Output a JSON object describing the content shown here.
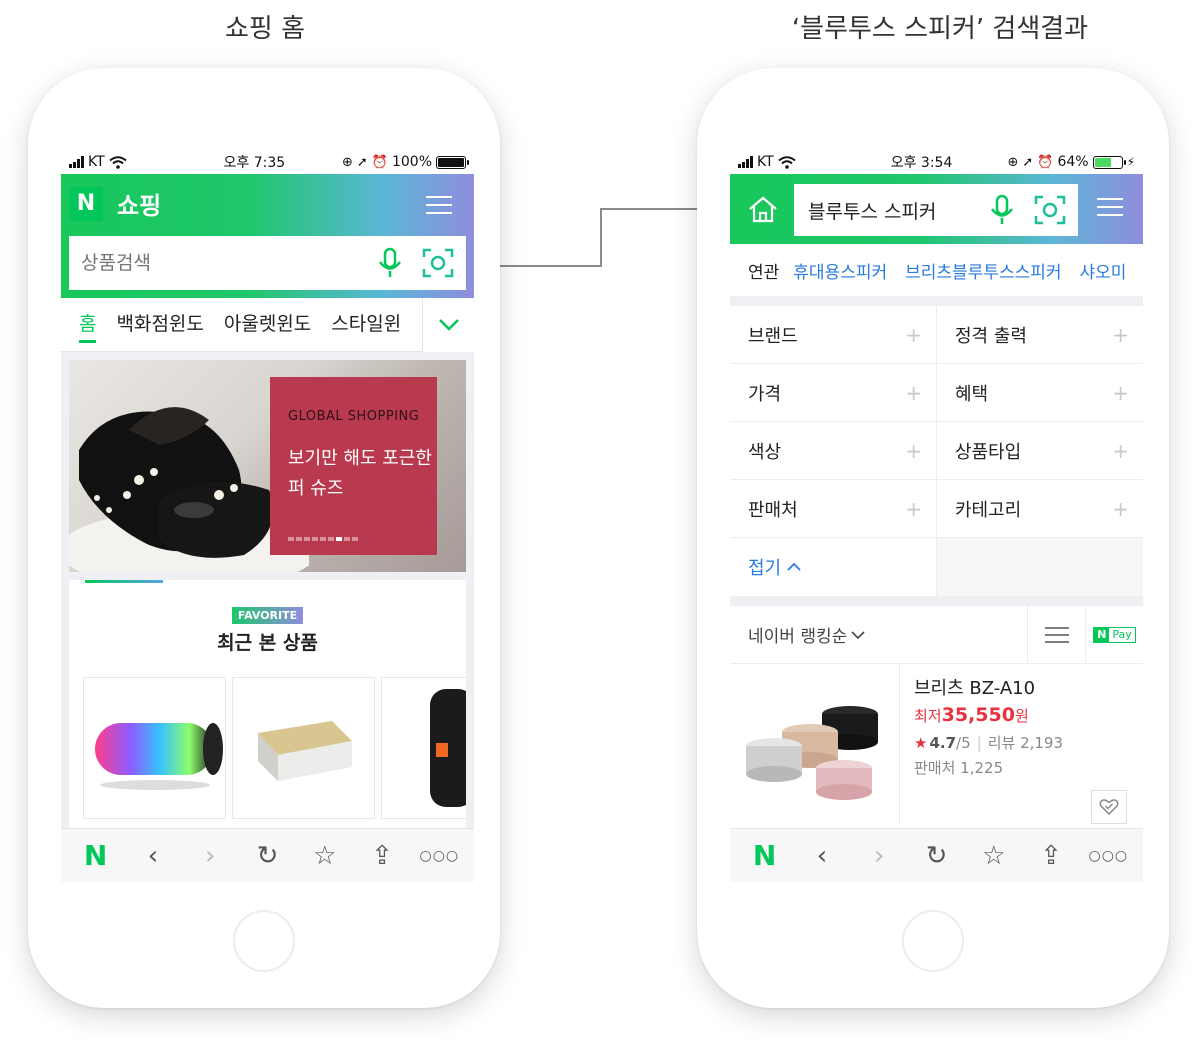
{
  "captions": {
    "left": "쇼핑 홈",
    "right": "‘블루투스 스피커’ 검색결과"
  },
  "left_phone": {
    "status": {
      "carrier": "KT",
      "time": "오후 7:35",
      "battery": "100%",
      "battery_level": 1.0
    },
    "header": {
      "logo": "N",
      "title": "쇼핑"
    },
    "search": {
      "placeholder": "상품검색"
    },
    "tabs": [
      "홈",
      "백화점윈도",
      "아울렛윈도",
      "스타일윈"
    ],
    "banner": {
      "kicker": "GLOBAL SHOPPING",
      "headline_1": "보기만 해도 포근한",
      "headline_2": "퍼 슈즈",
      "pager_count": 9,
      "pager_active": 7
    },
    "favorite": {
      "badge": "FAVORITE",
      "title": "최근 본 상품"
    }
  },
  "right_phone": {
    "status": {
      "carrier": "KT",
      "time": "오후 3:54",
      "battery": "64%",
      "battery_level": 0.64
    },
    "search": {
      "query": "블루투스 스피커"
    },
    "related": {
      "label": "연관",
      "items": [
        "휴대용스피커",
        "브리츠블루투스스피커",
        "샤오미"
      ]
    },
    "filters": [
      [
        "브랜드",
        "정격 출력"
      ],
      [
        "가격",
        "혜택"
      ],
      [
        "색상",
        "상품타입"
      ],
      [
        "판매처",
        "카테고리"
      ]
    ],
    "collapse_label": "접기",
    "sort": {
      "label": "네이버 랭킹순",
      "npay": "Pay",
      "npay_logo": "N"
    },
    "product": {
      "name": "브리츠 BZ-A10",
      "price_prefix": "최저",
      "price": "35,550",
      "price_suffix": "원",
      "rating": "4.7",
      "rating_suffix": "/5",
      "review_label": "리뷰 2,193",
      "seller_label": "판매처 1,225"
    }
  },
  "colors": {
    "naver_green": "#03c75a",
    "banner_red": "#b9394f",
    "price_red": "#e8323c",
    "link_blue": "#2a7ae2",
    "gradient_end": "#8f8ddd"
  },
  "icons": [
    "signal-icon",
    "wifi-icon",
    "lock-rotation-icon",
    "location-arrow-icon",
    "alarm-icon",
    "battery-icon",
    "mic-icon",
    "camera-lens-icon",
    "hamburger-menu-icon",
    "chevron-down-icon",
    "home-icon",
    "list-view-icon",
    "back-icon",
    "forward-icon",
    "refresh-icon",
    "bookmark-star-icon",
    "share-icon",
    "more-icon",
    "heart-check-icon",
    "star-icon",
    "chevron-up-icon"
  ]
}
